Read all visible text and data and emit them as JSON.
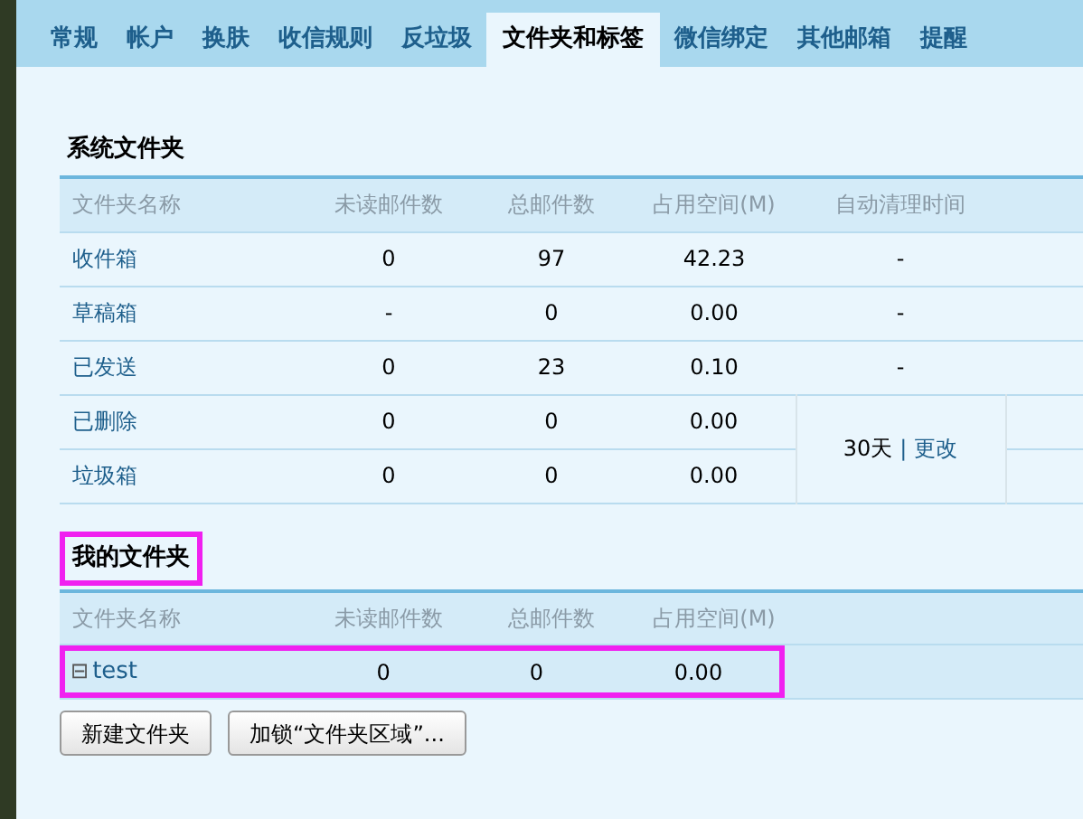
{
  "tabs": [
    {
      "label": "常规",
      "selected": false
    },
    {
      "label": "帐户",
      "selected": false
    },
    {
      "label": "换肤",
      "selected": false
    },
    {
      "label": "收信规则",
      "selected": false
    },
    {
      "label": "反垃圾",
      "selected": false
    },
    {
      "label": "文件夹和标签",
      "selected": true
    },
    {
      "label": "微信绑定",
      "selected": false
    },
    {
      "label": "其他邮箱",
      "selected": false
    },
    {
      "label": "提醒",
      "selected": false
    }
  ],
  "system_folders": {
    "title": "系统文件夹",
    "columns": [
      "文件夹名称",
      "未读邮件数",
      "总邮件数",
      "占用空间(M)",
      "自动清理时间"
    ],
    "rows": [
      {
        "name": "收件箱",
        "unread": "0",
        "total": "97",
        "size": "42.23",
        "cleanup": "-"
      },
      {
        "name": "草稿箱",
        "unread": "-",
        "total": "0",
        "size": "0.00",
        "cleanup": "-"
      },
      {
        "name": "已发送",
        "unread": "0",
        "total": "23",
        "size": "0.10",
        "cleanup": "-"
      },
      {
        "name": "已删除",
        "unread": "0",
        "total": "0",
        "size": "0.00"
      },
      {
        "name": "垃圾箱",
        "unread": "0",
        "total": "0",
        "size": "0.00"
      }
    ],
    "shared_cleanup": {
      "days": "30天",
      "separator": "|",
      "link": "更改"
    }
  },
  "my_folders": {
    "title": "我的文件夹",
    "highlighted": true,
    "columns": [
      "文件夹名称",
      "未读邮件数",
      "总邮件数",
      "占用空间(M)"
    ],
    "rows": [
      {
        "toggle": "⊟",
        "name": "test",
        "unread": "0",
        "total": "0",
        "size": "0.00",
        "highlighted": true
      }
    ]
  },
  "buttons": [
    "新建文件夹",
    "加锁“文件夹区域”..."
  ]
}
